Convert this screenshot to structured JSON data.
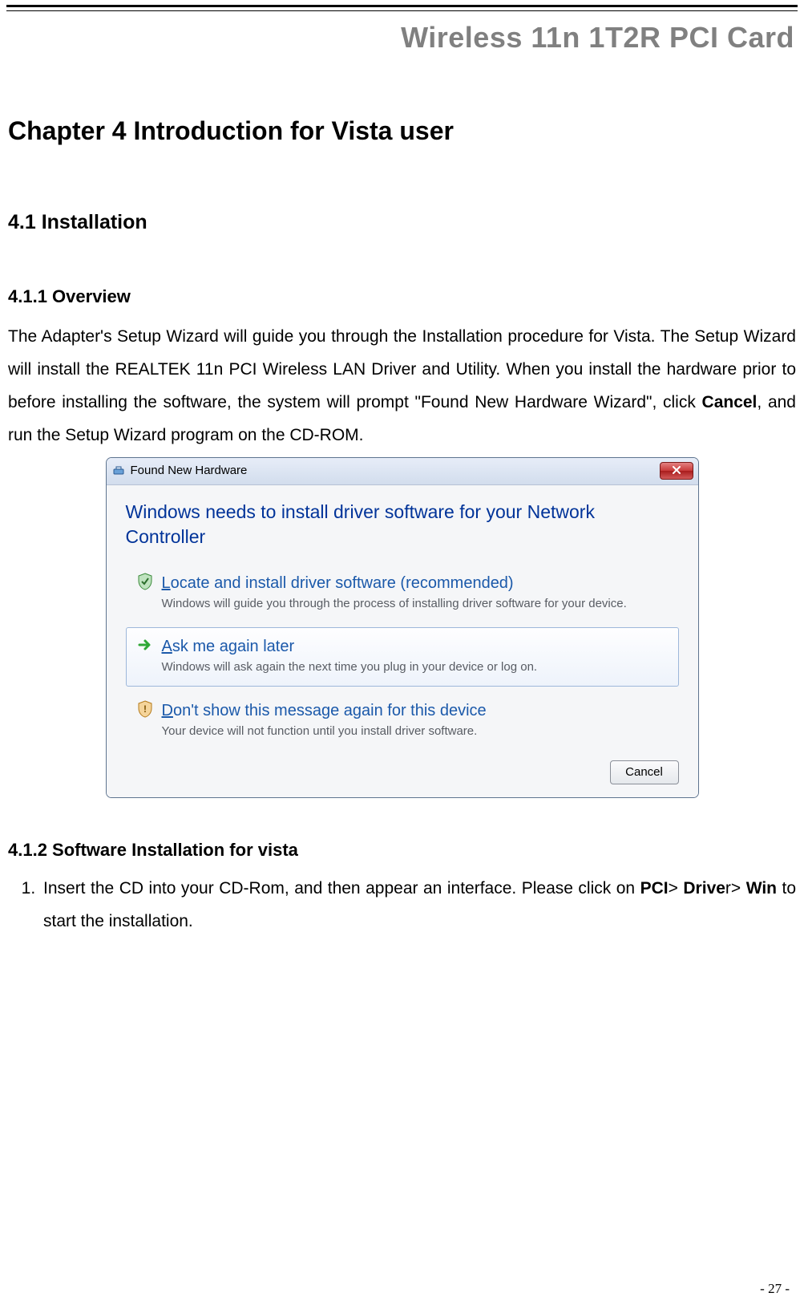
{
  "header": {
    "product": "Wireless 11n 1T2R PCI Card"
  },
  "chapter": {
    "label": "Chapter 4    Introduction for Vista user"
  },
  "s41": {
    "title": "4.1 Installation"
  },
  "s411": {
    "title": "4.1.1 Overview",
    "p_before_bold": "The Adapter's Setup Wizard will guide you through the Installation procedure for Vista. The Setup Wizard will install the REALTEK 11n PCI Wireless LAN Driver and Utility. When you install the hardware prior to before installing the software, the system will prompt \"Found New Hardware Wizard\", click ",
    "p_bold": "Cancel",
    "p_after_bold": ", and run the Setup Wizard program on the CD-ROM."
  },
  "dialog": {
    "title": "Found New Hardware",
    "heading": "Windows needs to install driver software for your Network Controller",
    "opts": [
      {
        "title": "Locate and install driver software (recommended)",
        "underline_first": true,
        "desc": "Windows will guide you through the process of installing driver software for your device."
      },
      {
        "title": "Ask me again later",
        "underline_first": true,
        "desc": "Windows will ask again the next time you plug in your device or log on."
      },
      {
        "title": "Don't show this message again for this device",
        "underline_first": true,
        "desc": "Your device will not function until you install driver software."
      }
    ],
    "cancel": "Cancel"
  },
  "s412": {
    "title": "4.1.2 Software Installation for vista",
    "step1_a": "Insert the CD into your CD-Rom, and then appear an interface. Please click on ",
    "b1": "PCI",
    "gt1": "> ",
    "b2": "Drive",
    "r": "r> ",
    "b3": "Win",
    "tail": " to start the installation."
  },
  "footer": {
    "page": "- 27 -"
  }
}
